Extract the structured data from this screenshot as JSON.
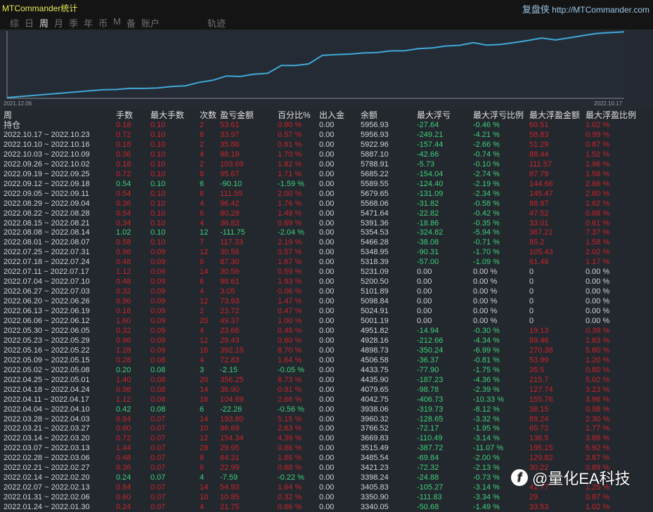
{
  "header": {
    "title": "MTCommander统计",
    "brand_cn": "复盘侠",
    "brand_url": "http://MTCommander.com"
  },
  "nav": [
    "综",
    "日",
    "周",
    "月",
    "季",
    "年",
    "币",
    "M",
    "备",
    "账户",
    "轨迹"
  ],
  "nav_active": "周",
  "chart": {
    "start_label": "2021.12.06",
    "end_label": "2022.10.17",
    "line_color": "#3fa9d8"
  },
  "columns": [
    "周",
    "手数",
    "最大手数",
    "次数",
    "盈亏金额",
    "百分比%",
    "出入金",
    "余额",
    "最大浮亏",
    "最大浮亏比例",
    "最大浮盈金额",
    "最大浮盈比例"
  ],
  "rows": [
    [
      "持仓",
      "0.18",
      "0.10",
      "2",
      "53.61",
      "0.90 %",
      "0.00",
      "5956.93",
      "-27.64",
      "-0.46 %",
      "60.51",
      "1.02 %"
    ],
    [
      "2022.10.17 ~ 2022.10.23",
      "0.72",
      "0.10",
      "8",
      "33.97",
      "0.57 %",
      "0.00",
      "5956.93",
      "-249.21",
      "-4.21 %",
      "58.83",
      "0.99 %"
    ],
    [
      "2022.10.10 ~ 2022.10.16",
      "0.18",
      "0.10",
      "2",
      "35.86",
      "0.61 %",
      "0.00",
      "5922.96",
      "-157.44",
      "-2.66 %",
      "51.29",
      "0.87 %"
    ],
    [
      "2022.10.03 ~ 2022.10.09",
      "0.36",
      "0.10",
      "4",
      "98.19",
      "1.70 %",
      "0.00",
      "5887.10",
      "-42.66",
      "-0.74 %",
      "88.44",
      "1.52 %"
    ],
    [
      "2022.09.26 ~ 2022.10.02",
      "0.18",
      "0.10",
      "2",
      "103.69",
      "1.82 %",
      "0.00",
      "5788.91",
      "-5.73",
      "-0.10 %",
      "111.57",
      "1.96 %"
    ],
    [
      "2022.09.19 ~ 2022.09.25",
      "0.72",
      "0.10",
      "8",
      "95.67",
      "1.71 %",
      "0.00",
      "5685.22",
      "-154.04",
      "-2.74 %",
      "87.79",
      "1.56 %"
    ],
    [
      "2022.09.12 ~ 2022.09.18",
      "0.54",
      "0.10",
      "6",
      "-90.10",
      "-1.59 %",
      "0.00",
      "5589.55",
      "-124.40",
      "-2.19 %",
      "144.66",
      "2.66 %"
    ],
    [
      "2022.09.05 ~ 2022.09.11",
      "0.54",
      "0.10",
      "6",
      "111.59",
      "2.00 %",
      "0.00",
      "5679.65",
      "-131.09",
      "-2.34 %",
      "145.47",
      "2.60 %"
    ],
    [
      "2022.08.29 ~ 2022.09.04",
      "0.36",
      "0.10",
      "4",
      "96.42",
      "1.76 %",
      "0.00",
      "5568.06",
      "-31.82",
      "-0.58 %",
      "88.97",
      "1.62 %"
    ],
    [
      "2022.08.22 ~ 2022.08.28",
      "0.54",
      "0.10",
      "6",
      "80.28",
      "1.49 %",
      "0.00",
      "5471.64",
      "-22.82",
      "-0.42 %",
      "47.52",
      "0.88 %"
    ],
    [
      "2022.08.15 ~ 2022.08.21",
      "0.34",
      "0.10",
      "4",
      "36.83",
      "0.69 %",
      "0.00",
      "5391.36",
      "-18.86",
      "-0.35 %",
      "33.01",
      "0.61 %"
    ],
    [
      "2022.08.08 ~ 2022.08.14",
      "1.02",
      "0.10",
      "12",
      "-111.75",
      "-2.04 %",
      "0.00",
      "5354.53",
      "-324.82",
      "-5.94 %",
      "367.21",
      "7.37 %"
    ],
    [
      "2022.08.01 ~ 2022.08.07",
      "0.58",
      "0.10",
      "7",
      "117.33",
      "2.19 %",
      "0.00",
      "5466.28",
      "-38.08",
      "-0.71 %",
      "85.2",
      "1.58 %"
    ],
    [
      "2022.07.25 ~ 2022.07.31",
      "0.96",
      "0.09",
      "12",
      "30.56",
      "0.57 %",
      "0.00",
      "5348.95",
      "-90.31",
      "-1.70 %",
      "105.43",
      "2.02 %"
    ],
    [
      "2022.07.18 ~ 2022.07.24",
      "0.48",
      "0.09",
      "6",
      "87.30",
      "1.67 %",
      "0.00",
      "5318.39",
      "-57.00",
      "-1.09 %",
      "61.46",
      "1.17 %"
    ],
    [
      "2022.07.11 ~ 2022.07.17",
      "1.12",
      "0.09",
      "14",
      "30.59",
      "0.59 %",
      "0.00",
      "5231.09",
      "0.00",
      "0.00 %",
      "0",
      "0.00 %"
    ],
    [
      "2022.07.04 ~ 2022.07.10",
      "0.48",
      "0.09",
      "6",
      "98.61",
      "1.93 %",
      "0.00",
      "5200.50",
      "0.00",
      "0.00 %",
      "0",
      "0.00 %"
    ],
    [
      "2022.06.27 ~ 2022.07.03",
      "0.32",
      "0.09",
      "4",
      "3.05",
      "0.06 %",
      "0.00",
      "5101.89",
      "0.00",
      "0.00 %",
      "0",
      "0.00 %"
    ],
    [
      "2022.06.20 ~ 2022.06.26",
      "0.96",
      "0.09",
      "12",
      "73.93",
      "1.47 %",
      "0.00",
      "5098.84",
      "0.00",
      "0.00 %",
      "0",
      "0.00 %"
    ],
    [
      "2022.06.13 ~ 2022.06.19",
      "0.16",
      "0.09",
      "2",
      "23.72",
      "0.47 %",
      "0.00",
      "5024.91",
      "0.00",
      "0.00 %",
      "0",
      "0.00 %"
    ],
    [
      "2022.06.06 ~ 2022.06.12",
      "1.60",
      "0.09",
      "20",
      "49.37",
      "1.00 %",
      "0.00",
      "5001.19",
      "0.00",
      "0.00 %",
      "0",
      "0.00 %"
    ],
    [
      "2022.05.30 ~ 2022.06.05",
      "0.32",
      "0.09",
      "4",
      "23.66",
      "0.48 %",
      "0.00",
      "4951.82",
      "-14.94",
      "-0.30 %",
      "19.13",
      "0.39 %"
    ],
    [
      "2022.05.23 ~ 2022.05.29",
      "0.96",
      "0.09",
      "12",
      "29.43",
      "0.60 %",
      "0.00",
      "4928.16",
      "-212.66",
      "-4.34 %",
      "89.46",
      "1.83 %"
    ],
    [
      "2022.05.16 ~ 2022.05.22",
      "1.28",
      "0.09",
      "16",
      "392.15",
      "8.70 %",
      "0.00",
      "4898.73",
      "-350.24",
      "-6.99 %",
      "270.38",
      "5.80 %"
    ],
    [
      "2022.05.09 ~ 2022.05.15",
      "0.28",
      "0.08",
      "4",
      "72.83",
      "1.64 %",
      "0.00",
      "4506.58",
      "-36.37",
      "-0.81 %",
      "53.99",
      "1.20 %"
    ],
    [
      "2022.05.02 ~ 2022.05.08",
      "0.20",
      "0.08",
      "3",
      "-2.15",
      "-0.05 %",
      "0.00",
      "4433.75",
      "-77.90",
      "-1.75 %",
      "35.5",
      "0.80 %"
    ],
    [
      "2022.04.25 ~ 2022.05.01",
      "1.40",
      "0.08",
      "20",
      "356.25",
      "8.73 %",
      "0.00",
      "4435.90",
      "-187.23",
      "-4.36 %",
      "215.7",
      "5.02 %"
    ],
    [
      "2022.04.18 ~ 2022.04.24",
      "0.98",
      "0.08",
      "14",
      "36.90",
      "0.91 %",
      "0.00",
      "4079.65",
      "-98.78",
      "-2.39 %",
      "127.74",
      "3.23 %"
    ],
    [
      "2022.04.11 ~ 2022.04.17",
      "1.12",
      "0.08",
      "16",
      "104.69",
      "2.66 %",
      "0.00",
      "4042.75",
      "-406.73",
      "-10.33 %",
      "155.76",
      "3.96 %"
    ],
    [
      "2022.04.04 ~ 2022.04.10",
      "0.42",
      "0.08",
      "6",
      "-22.26",
      "-0.56 %",
      "0.00",
      "3938.06",
      "-319.73",
      "-8.12 %",
      "38.15",
      "0.98 %"
    ],
    [
      "2022.03.28 ~ 2022.04.03",
      "0.84",
      "0.07",
      "14",
      "193.80",
      "5.15 %",
      "0.00",
      "3960.32",
      "-128.65",
      "-3.32 %",
      "89.24",
      "2.30 %"
    ],
    [
      "2022.03.21 ~ 2022.03.27",
      "0.60",
      "0.07",
      "10",
      "96.69",
      "2.63 %",
      "0.00",
      "3766.52",
      "-72.17",
      "-1.95 %",
      "65.72",
      "1.77 %"
    ],
    [
      "2022.03.14 ~ 2022.03.20",
      "0.72",
      "0.07",
      "12",
      "154.34",
      "4.39 %",
      "0.00",
      "3669.83",
      "-110.49",
      "-3.14 %",
      "136.5",
      "3.88 %"
    ],
    [
      "2022.03.07 ~ 2022.03.13",
      "1.44",
      "0.07",
      "28",
      "29.95",
      "0.86 %",
      "0.00",
      "3515.49",
      "-387.72",
      "-11.07 %",
      "195.15",
      "5.92 %"
    ],
    [
      "2022.02.28 ~ 2022.03.06",
      "0.48",
      "0.07",
      "8",
      "64.31",
      "1.86 %",
      "0.00",
      "3485.54",
      "-69.84",
      "-2.00 %",
      "129.82",
      "3.87 %"
    ],
    [
      "2022.02.21 ~ 2022.02.27",
      "0.36",
      "0.07",
      "6",
      "22.99",
      "0.68 %",
      "0.00",
      "3421.23",
      "-72.32",
      "-2.13 %",
      "30.22",
      "0.89 %"
    ],
    [
      "2022.02.14 ~ 2022.02.20",
      "0.24",
      "0.07",
      "4",
      "-7.59",
      "-0.22 %",
      "0.00",
      "3398.24",
      "-24.88",
      "-0.73 %",
      "",
      ""
    ],
    [
      "2022.02.07 ~ 2022.02.13",
      "0.84",
      "0.07",
      "14",
      "54.93",
      "1.64 %",
      "0.00",
      "3405.83",
      "-105.27",
      "-3.14 %",
      "41.77",
      "1.25 %"
    ],
    [
      "2022.01.31 ~ 2022.02.06",
      "0.60",
      "0.07",
      "10",
      "10.85",
      "0.32 %",
      "0.00",
      "3350.90",
      "-111.83",
      "-3.34 %",
      "29",
      "0.87 %"
    ],
    [
      "2022.01.24 ~ 2022.01.30",
      "0.24",
      "0.07",
      "4",
      "21.75",
      "0.66 %",
      "0.00",
      "3340.05",
      "-50.68",
      "-1.49 %",
      "33.53",
      "1.02 %"
    ]
  ],
  "watermark": {
    "logo": "f",
    "text": "@量化EA科技"
  }
}
